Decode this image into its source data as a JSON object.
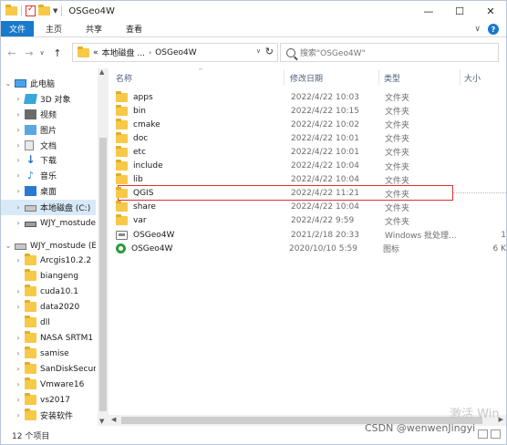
{
  "window": {
    "title": "OSGeo4W"
  },
  "window_controls": {
    "minimize": "—",
    "maximize": "☐",
    "close": "✕"
  },
  "ribbon": {
    "file": "文件",
    "home": "主页",
    "share": "共享",
    "view": "查看"
  },
  "address": {
    "overflow": "«",
    "crumbs": [
      "本地磁盘 ...",
      "OSGeo4W"
    ]
  },
  "search": {
    "placeholder": "搜索\"OSGeo4W\""
  },
  "nav_tree": [
    {
      "label": "此电脑",
      "icon": "pc-icon",
      "expand": "v"
    },
    {
      "label": "3D 对象",
      "icon": "3d-objects-icon",
      "expand": ">"
    },
    {
      "label": "视频",
      "icon": "video-icon",
      "expand": ">"
    },
    {
      "label": "图片",
      "icon": "pictures-icon",
      "expand": ">"
    },
    {
      "label": "文档",
      "icon": "documents-icon",
      "expand": ">"
    },
    {
      "label": "下载",
      "icon": "download-icon",
      "expand": ">"
    },
    {
      "label": "音乐",
      "icon": "music-icon",
      "expand": ">"
    },
    {
      "label": "桌面",
      "icon": "desktop-icon",
      "expand": ">"
    },
    {
      "label": "本地磁盘 (C:)",
      "icon": "drive-icon",
      "expand": ">",
      "selected": true
    },
    {
      "label": "WJY_mostude (",
      "icon": "network-drive-icon",
      "expand": ">"
    },
    {
      "label": "WJY_mostude (E",
      "icon": "drive-icon",
      "expand": "v"
    },
    {
      "label": "Arcgis10.2.2",
      "icon": "folder-icon",
      "expand": ">"
    },
    {
      "label": "biangeng",
      "icon": "folder-icon",
      "expand": ""
    },
    {
      "label": "cuda10.1",
      "icon": "folder-icon",
      "expand": ">"
    },
    {
      "label": "data2020",
      "icon": "folder-icon",
      "expand": ">"
    },
    {
      "label": "dll",
      "icon": "folder-icon",
      "expand": ""
    },
    {
      "label": "NASA SRTM1 v",
      "icon": "folder-icon",
      "expand": ">"
    },
    {
      "label": "samise",
      "icon": "folder-icon",
      "expand": ">"
    },
    {
      "label": "SanDiskSecure",
      "icon": "folder-icon",
      "expand": ">"
    },
    {
      "label": "Vmware16",
      "icon": "folder-icon",
      "expand": ">"
    },
    {
      "label": "vs2017",
      "icon": "folder-icon",
      "expand": ">"
    },
    {
      "label": "安装软件",
      "icon": "folder-icon",
      "expand": ">"
    }
  ],
  "columns": {
    "name": "名称",
    "date": "修改日期",
    "type": "类型",
    "size": "大小"
  },
  "files": [
    {
      "name": "apps",
      "date": "2022/4/22 10:03",
      "type": "文件夹",
      "size": "",
      "icon": "folder-icon"
    },
    {
      "name": "bin",
      "date": "2022/4/22 10:15",
      "type": "文件夹",
      "size": "",
      "icon": "folder-icon"
    },
    {
      "name": "cmake",
      "date": "2022/4/22 10:02",
      "type": "文件夹",
      "size": "",
      "icon": "folder-icon"
    },
    {
      "name": "doc",
      "date": "2022/4/22 10:01",
      "type": "文件夹",
      "size": "",
      "icon": "folder-icon"
    },
    {
      "name": "etc",
      "date": "2022/4/22 10:01",
      "type": "文件夹",
      "size": "",
      "icon": "folder-icon"
    },
    {
      "name": "include",
      "date": "2022/4/22 10:04",
      "type": "文件夹",
      "size": "",
      "icon": "folder-icon"
    },
    {
      "name": "lib",
      "date": "2022/4/22 10:04",
      "type": "文件夹",
      "size": "",
      "icon": "folder-icon"
    },
    {
      "name": "QGIS",
      "date": "2022/4/22 11:21",
      "type": "文件夹",
      "size": "",
      "icon": "folder-icon",
      "highlighted": true
    },
    {
      "name": "share",
      "date": "2022/4/22 10:04",
      "type": "文件夹",
      "size": "",
      "icon": "folder-icon"
    },
    {
      "name": "var",
      "date": "2022/4/22 9:59",
      "type": "文件夹",
      "size": "",
      "icon": "folder-icon"
    },
    {
      "name": "OSGeo4W",
      "date": "2021/2/18 20:33",
      "type": "Windows 批处理...",
      "size": "1",
      "icon": "batch-file-icon"
    },
    {
      "name": "OSGeo4W",
      "date": "2020/10/10 5:59",
      "type": "图标",
      "size": "6 K",
      "icon": "osgeo-icon"
    }
  ],
  "status": {
    "count": "12 个项目"
  },
  "watermark": {
    "activate": "激活 Win",
    "csdn": "CSDN @wenwenJingyi"
  },
  "colors": {
    "ribbon_file_tab": "#1979ca",
    "highlight_box": "#e03030",
    "selected_nav": "#d8e9f8"
  }
}
